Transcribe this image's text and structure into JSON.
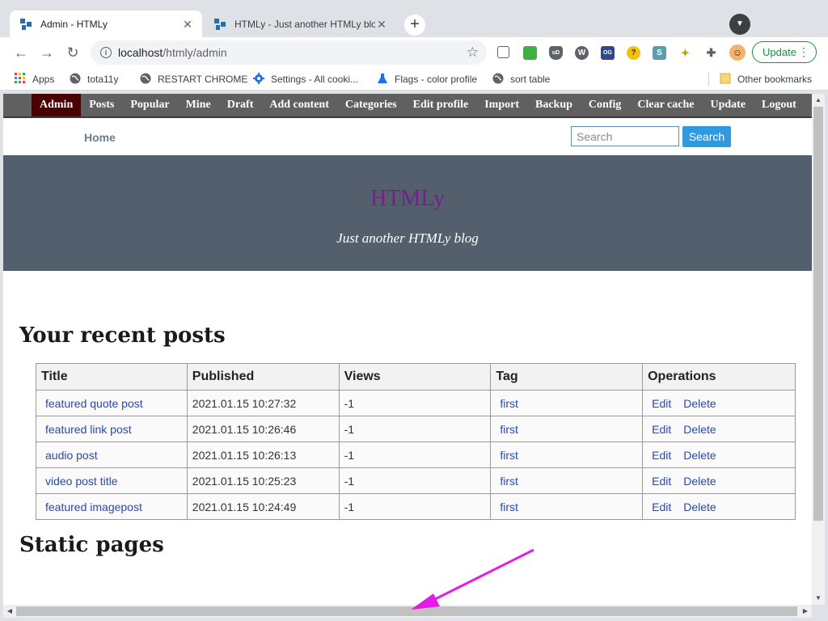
{
  "window": {
    "controls": [
      "–",
      "□",
      "✕"
    ]
  },
  "tabs": [
    {
      "title": "Admin - HTMLy",
      "active": true
    },
    {
      "title": "HTMLy - Just another HTMLy blog",
      "active": false
    }
  ],
  "newtab_label": "+",
  "toolbar": {
    "url_host": "localhost",
    "url_path": "/htmly/admin",
    "update_label": "Update"
  },
  "bookmarks": {
    "items": [
      {
        "label": "Apps",
        "icon": "apps-grid-icon"
      },
      {
        "label": "tota11y",
        "icon": "globe-icon"
      },
      {
        "label": "RESTART CHROME",
        "icon": "globe-icon"
      },
      {
        "label": "Settings - All cooki...",
        "icon": "gear-icon"
      },
      {
        "label": "Flags - color profile",
        "icon": "flask-icon"
      },
      {
        "label": "sort table",
        "icon": "globe-icon"
      }
    ],
    "other": "Other bookmarks"
  },
  "admin_menu": [
    "Admin",
    "Posts",
    "Popular",
    "Mine",
    "Draft",
    "Add content",
    "Categories",
    "Edit profile",
    "Import",
    "Backup",
    "Config",
    "Clear cache",
    "Update",
    "Logout"
  ],
  "site_nav": {
    "home": "Home",
    "search_placeholder": "Search",
    "search_button": "Search"
  },
  "hero": {
    "title": "HTMLy",
    "tagline": "Just another HTMLy blog"
  },
  "recent_posts": {
    "heading": "Your recent posts",
    "columns": [
      "Title",
      "Published",
      "Views",
      "Tag",
      "Operations"
    ],
    "rows": [
      {
        "title": "featured quote post",
        "published": "2021.01.15 10:27:32",
        "views": "-1",
        "tag": "first",
        "edit": "Edit",
        "delete": "Delete"
      },
      {
        "title": "featured link post",
        "published": "2021.01.15 10:26:46",
        "views": "-1",
        "tag": "first",
        "edit": "Edit",
        "delete": "Delete"
      },
      {
        "title": "audio post",
        "published": "2021.01.15 10:26:13",
        "views": "-1",
        "tag": "first",
        "edit": "Edit",
        "delete": "Delete"
      },
      {
        "title": "video post title",
        "published": "2021.01.15 10:25:23",
        "views": "-1",
        "tag": "first",
        "edit": "Edit",
        "delete": "Delete"
      },
      {
        "title": "featured imagepost",
        "published": "2021.01.15 10:24:49",
        "views": "-1",
        "tag": "first",
        "edit": "Edit",
        "delete": "Delete"
      }
    ]
  },
  "static_pages": {
    "heading": "Static pages"
  },
  "colors": {
    "admin_bar": "#606060",
    "admin_active": "#4a0000",
    "hero_bg": "#535f6c",
    "hero_title": "#7a1d8a",
    "link": "#2549b5",
    "annotation_arrow": "#e31ce3"
  }
}
